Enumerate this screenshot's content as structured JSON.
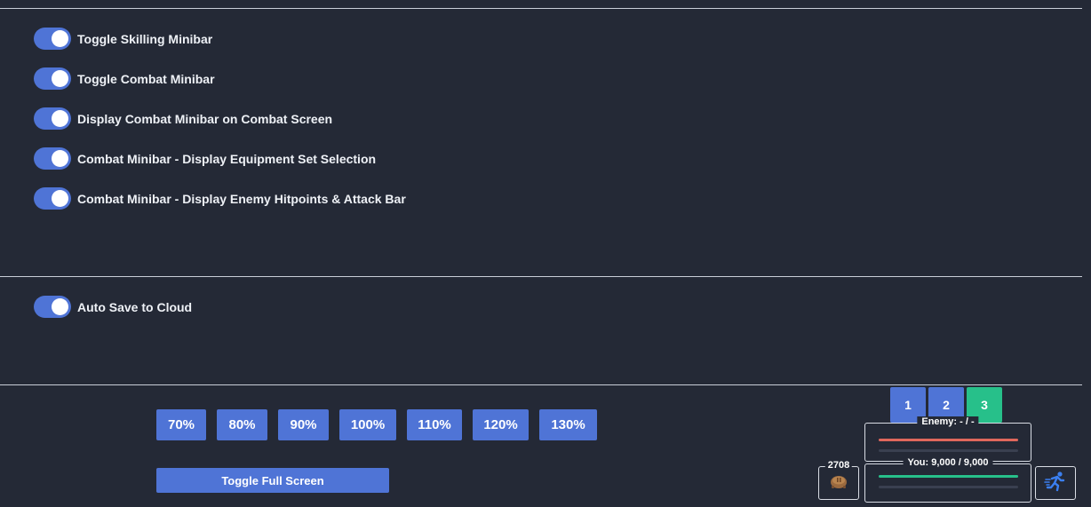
{
  "settings": {
    "minibar_section": [
      {
        "label": "Toggle Skilling Minibar",
        "enabled": true
      },
      {
        "label": "Toggle Combat Minibar",
        "enabled": true
      },
      {
        "label": "Display Combat Minibar on Combat Screen",
        "enabled": true
      },
      {
        "label": "Combat Minibar - Display Equipment Set Selection",
        "enabled": true
      },
      {
        "label": "Combat Minibar - Display Enemy Hitpoints & Attack Bar",
        "enabled": true
      }
    ],
    "cloud_section": [
      {
        "label": "Auto Save to Cloud",
        "enabled": true
      }
    ]
  },
  "zoom": {
    "options": [
      "70%",
      "80%",
      "90%",
      "100%",
      "110%",
      "120%",
      "130%"
    ]
  },
  "fullscreen": {
    "label": "Toggle Full Screen"
  },
  "combat_minibar": {
    "equipment_sets": [
      {
        "label": "1",
        "active": false
      },
      {
        "label": "2",
        "active": false
      },
      {
        "label": "3",
        "active": true
      }
    ],
    "enemy": {
      "label": "Enemy: - / -",
      "hp_fraction": 1.0,
      "attack_fraction": 0.0,
      "hp_color": "#e0675c"
    },
    "player": {
      "label": "You: 9,000 / 9,000",
      "hp_fraction": 1.0,
      "attack_fraction": 0.0,
      "hp_color": "#27c08a"
    },
    "food": {
      "count": "2708",
      "icon": "food-icon"
    },
    "run": {
      "icon": "run-icon"
    }
  },
  "colors": {
    "accent": "#4f74d6",
    "active_set": "#27c08a",
    "background": "#242936"
  }
}
